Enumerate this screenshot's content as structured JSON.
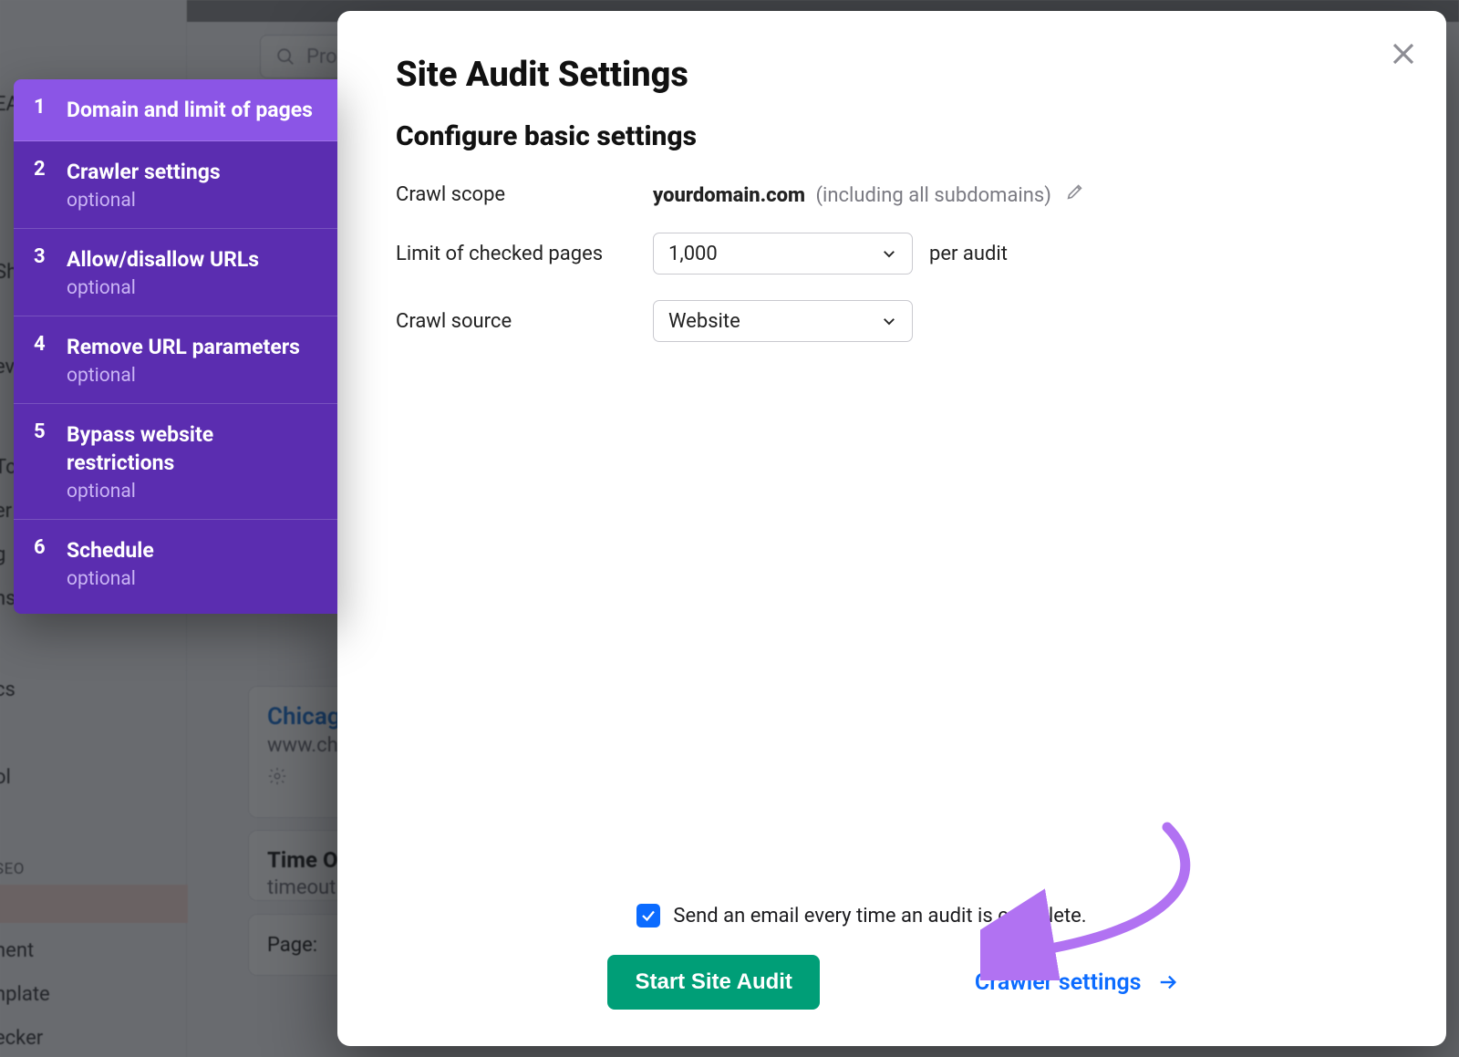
{
  "background": {
    "search_placeholder": "Pro",
    "card1_title": "Chicago",
    "card1_sub": "www.ch",
    "card2_title": "Time O",
    "card2_sub": "timeout",
    "card3_label": "Page:",
    "side": {
      "ev": "ev",
      "tc": "Tc",
      "er": "er",
      "g": "g",
      "ns": "ns",
      "cs": "cs",
      "ol": "ol",
      "seo": "SEO",
      "nent": "nent",
      "nplate": "nplate",
      "ecker": "ecker"
    }
  },
  "wizard": {
    "items": [
      {
        "num": "1",
        "title": "Domain and limit of pages",
        "optional": ""
      },
      {
        "num": "2",
        "title": "Crawler settings",
        "optional": "optional"
      },
      {
        "num": "3",
        "title": "Allow/disallow URLs",
        "optional": "optional"
      },
      {
        "num": "4",
        "title": "Remove URL parameters",
        "optional": "optional"
      },
      {
        "num": "5",
        "title": "Bypass website restrictions",
        "optional": "optional"
      },
      {
        "num": "6",
        "title": "Schedule",
        "optional": "optional"
      }
    ]
  },
  "modal": {
    "heading": "Site Audit Settings",
    "subheading": "Configure basic settings",
    "scope_label": "Crawl scope",
    "scope_value": "yourdomain.com",
    "scope_note": "(including all subdomains)",
    "limit_label": "Limit of checked pages",
    "limit_value": "1,000",
    "limit_suffix": "per audit",
    "source_label": "Crawl source",
    "source_value": "Website",
    "email_text": "Send an email every time an audit is complete.",
    "start_button": "Start Site Audit",
    "next_link": "Crawler settings"
  }
}
